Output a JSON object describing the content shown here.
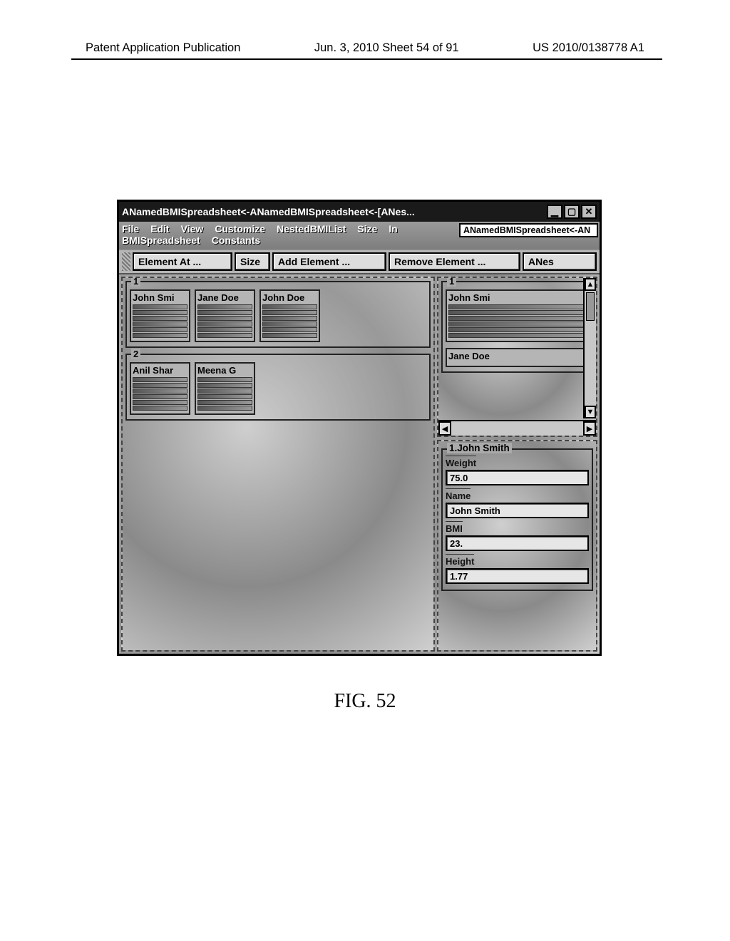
{
  "page": {
    "header_left": "Patent Application Publication",
    "header_center": "Jun. 3, 2010  Sheet 54 of 91",
    "header_right": "US 2010/0138778 A1",
    "figure_caption": "FIG. 52"
  },
  "window": {
    "title": "ANamedBMISpreadsheet<-ANamedBMISpreadsheet<-[ANes...",
    "dropdown_value": "ANamedBMISpreadsheet<-AN",
    "menubar": [
      "File",
      "Edit",
      "View",
      "Customize",
      "NestedBMIList",
      "Size",
      "In",
      "BMISpreadsheet",
      "Constants"
    ],
    "toolbar": {
      "element_at": "Element At ...",
      "size": "Size",
      "add_element": "Add Element ...",
      "remove_element": "Remove Element ...",
      "anes": "ANes"
    }
  },
  "left_groups": [
    {
      "label": "1",
      "cards": [
        "John Smi",
        "Jane Doe",
        "John Doe"
      ]
    },
    {
      "label": "2",
      "cards": [
        "Anil Shar",
        "Meena G"
      ]
    }
  ],
  "right_list": {
    "group_label": "1",
    "items": [
      "John Smi",
      "Jane Doe"
    ]
  },
  "detail": {
    "title": "1.John Smith",
    "fields": [
      {
        "label": "Weight",
        "value": "75.0"
      },
      {
        "label": "Name",
        "value": "John Smith"
      },
      {
        "label": "BMI",
        "value": "23."
      },
      {
        "label": "Height",
        "value": "1.77"
      }
    ]
  }
}
